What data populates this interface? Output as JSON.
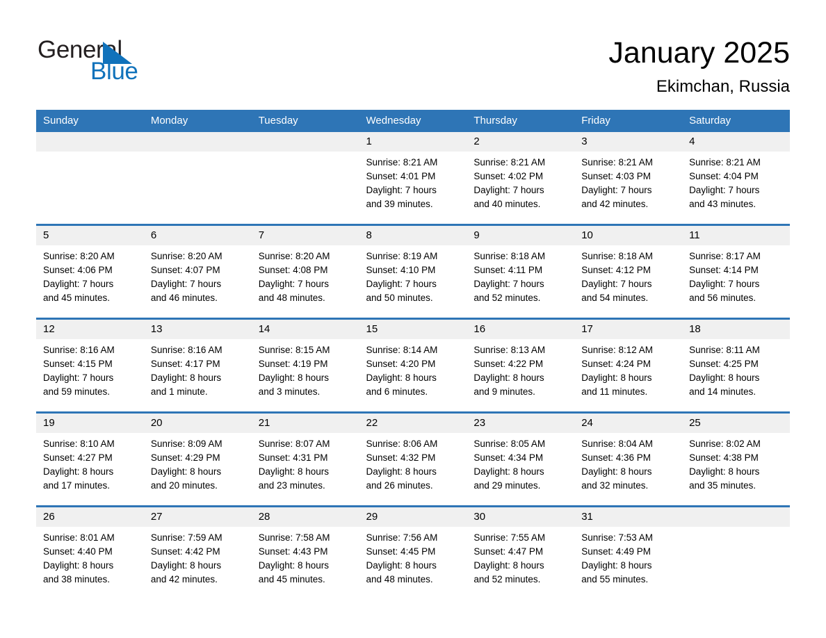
{
  "brand": {
    "name_part1": "General",
    "name_part2": "Blue",
    "accent_color": "#1072bb",
    "triangle_icon": "triangle-icon"
  },
  "header": {
    "title": "January 2025",
    "subtitle": "Ekimchan, Russia"
  },
  "theme": {
    "header_blue": "#2e75b6",
    "daynum_band": "#f0f0f0",
    "page_background": "#ffffff"
  },
  "calendar": {
    "day_headers": [
      "Sunday",
      "Monday",
      "Tuesday",
      "Wednesday",
      "Thursday",
      "Friday",
      "Saturday"
    ],
    "weeks": [
      [
        {
          "day": "",
          "blank": true
        },
        {
          "day": "",
          "blank": true
        },
        {
          "day": "",
          "blank": true
        },
        {
          "day": "1",
          "sunrise": "Sunrise: 8:21 AM",
          "sunset": "Sunset: 4:01 PM",
          "daylight1": "Daylight: 7 hours",
          "daylight2": "and 39 minutes."
        },
        {
          "day": "2",
          "sunrise": "Sunrise: 8:21 AM",
          "sunset": "Sunset: 4:02 PM",
          "daylight1": "Daylight: 7 hours",
          "daylight2": "and 40 minutes."
        },
        {
          "day": "3",
          "sunrise": "Sunrise: 8:21 AM",
          "sunset": "Sunset: 4:03 PM",
          "daylight1": "Daylight: 7 hours",
          "daylight2": "and 42 minutes."
        },
        {
          "day": "4",
          "sunrise": "Sunrise: 8:21 AM",
          "sunset": "Sunset: 4:04 PM",
          "daylight1": "Daylight: 7 hours",
          "daylight2": "and 43 minutes."
        }
      ],
      [
        {
          "day": "5",
          "sunrise": "Sunrise: 8:20 AM",
          "sunset": "Sunset: 4:06 PM",
          "daylight1": "Daylight: 7 hours",
          "daylight2": "and 45 minutes."
        },
        {
          "day": "6",
          "sunrise": "Sunrise: 8:20 AM",
          "sunset": "Sunset: 4:07 PM",
          "daylight1": "Daylight: 7 hours",
          "daylight2": "and 46 minutes."
        },
        {
          "day": "7",
          "sunrise": "Sunrise: 8:20 AM",
          "sunset": "Sunset: 4:08 PM",
          "daylight1": "Daylight: 7 hours",
          "daylight2": "and 48 minutes."
        },
        {
          "day": "8",
          "sunrise": "Sunrise: 8:19 AM",
          "sunset": "Sunset: 4:10 PM",
          "daylight1": "Daylight: 7 hours",
          "daylight2": "and 50 minutes."
        },
        {
          "day": "9",
          "sunrise": "Sunrise: 8:18 AM",
          "sunset": "Sunset: 4:11 PM",
          "daylight1": "Daylight: 7 hours",
          "daylight2": "and 52 minutes."
        },
        {
          "day": "10",
          "sunrise": "Sunrise: 8:18 AM",
          "sunset": "Sunset: 4:12 PM",
          "daylight1": "Daylight: 7 hours",
          "daylight2": "and 54 minutes."
        },
        {
          "day": "11",
          "sunrise": "Sunrise: 8:17 AM",
          "sunset": "Sunset: 4:14 PM",
          "daylight1": "Daylight: 7 hours",
          "daylight2": "and 56 minutes."
        }
      ],
      [
        {
          "day": "12",
          "sunrise": "Sunrise: 8:16 AM",
          "sunset": "Sunset: 4:15 PM",
          "daylight1": "Daylight: 7 hours",
          "daylight2": "and 59 minutes."
        },
        {
          "day": "13",
          "sunrise": "Sunrise: 8:16 AM",
          "sunset": "Sunset: 4:17 PM",
          "daylight1": "Daylight: 8 hours",
          "daylight2": "and 1 minute."
        },
        {
          "day": "14",
          "sunrise": "Sunrise: 8:15 AM",
          "sunset": "Sunset: 4:19 PM",
          "daylight1": "Daylight: 8 hours",
          "daylight2": "and 3 minutes."
        },
        {
          "day": "15",
          "sunrise": "Sunrise: 8:14 AM",
          "sunset": "Sunset: 4:20 PM",
          "daylight1": "Daylight: 8 hours",
          "daylight2": "and 6 minutes."
        },
        {
          "day": "16",
          "sunrise": "Sunrise: 8:13 AM",
          "sunset": "Sunset: 4:22 PM",
          "daylight1": "Daylight: 8 hours",
          "daylight2": "and 9 minutes."
        },
        {
          "day": "17",
          "sunrise": "Sunrise: 8:12 AM",
          "sunset": "Sunset: 4:24 PM",
          "daylight1": "Daylight: 8 hours",
          "daylight2": "and 11 minutes."
        },
        {
          "day": "18",
          "sunrise": "Sunrise: 8:11 AM",
          "sunset": "Sunset: 4:25 PM",
          "daylight1": "Daylight: 8 hours",
          "daylight2": "and 14 minutes."
        }
      ],
      [
        {
          "day": "19",
          "sunrise": "Sunrise: 8:10 AM",
          "sunset": "Sunset: 4:27 PM",
          "daylight1": "Daylight: 8 hours",
          "daylight2": "and 17 minutes."
        },
        {
          "day": "20",
          "sunrise": "Sunrise: 8:09 AM",
          "sunset": "Sunset: 4:29 PM",
          "daylight1": "Daylight: 8 hours",
          "daylight2": "and 20 minutes."
        },
        {
          "day": "21",
          "sunrise": "Sunrise: 8:07 AM",
          "sunset": "Sunset: 4:31 PM",
          "daylight1": "Daylight: 8 hours",
          "daylight2": "and 23 minutes."
        },
        {
          "day": "22",
          "sunrise": "Sunrise: 8:06 AM",
          "sunset": "Sunset: 4:32 PM",
          "daylight1": "Daylight: 8 hours",
          "daylight2": "and 26 minutes."
        },
        {
          "day": "23",
          "sunrise": "Sunrise: 8:05 AM",
          "sunset": "Sunset: 4:34 PM",
          "daylight1": "Daylight: 8 hours",
          "daylight2": "and 29 minutes."
        },
        {
          "day": "24",
          "sunrise": "Sunrise: 8:04 AM",
          "sunset": "Sunset: 4:36 PM",
          "daylight1": "Daylight: 8 hours",
          "daylight2": "and 32 minutes."
        },
        {
          "day": "25",
          "sunrise": "Sunrise: 8:02 AM",
          "sunset": "Sunset: 4:38 PM",
          "daylight1": "Daylight: 8 hours",
          "daylight2": "and 35 minutes."
        }
      ],
      [
        {
          "day": "26",
          "sunrise": "Sunrise: 8:01 AM",
          "sunset": "Sunset: 4:40 PM",
          "daylight1": "Daylight: 8 hours",
          "daylight2": "and 38 minutes."
        },
        {
          "day": "27",
          "sunrise": "Sunrise: 7:59 AM",
          "sunset": "Sunset: 4:42 PM",
          "daylight1": "Daylight: 8 hours",
          "daylight2": "and 42 minutes."
        },
        {
          "day": "28",
          "sunrise": "Sunrise: 7:58 AM",
          "sunset": "Sunset: 4:43 PM",
          "daylight1": "Daylight: 8 hours",
          "daylight2": "and 45 minutes."
        },
        {
          "day": "29",
          "sunrise": "Sunrise: 7:56 AM",
          "sunset": "Sunset: 4:45 PM",
          "daylight1": "Daylight: 8 hours",
          "daylight2": "and 48 minutes."
        },
        {
          "day": "30",
          "sunrise": "Sunrise: 7:55 AM",
          "sunset": "Sunset: 4:47 PM",
          "daylight1": "Daylight: 8 hours",
          "daylight2": "and 52 minutes."
        },
        {
          "day": "31",
          "sunrise": "Sunrise: 7:53 AM",
          "sunset": "Sunset: 4:49 PM",
          "daylight1": "Daylight: 8 hours",
          "daylight2": "and 55 minutes."
        },
        {
          "day": "",
          "blank": true
        }
      ]
    ]
  }
}
